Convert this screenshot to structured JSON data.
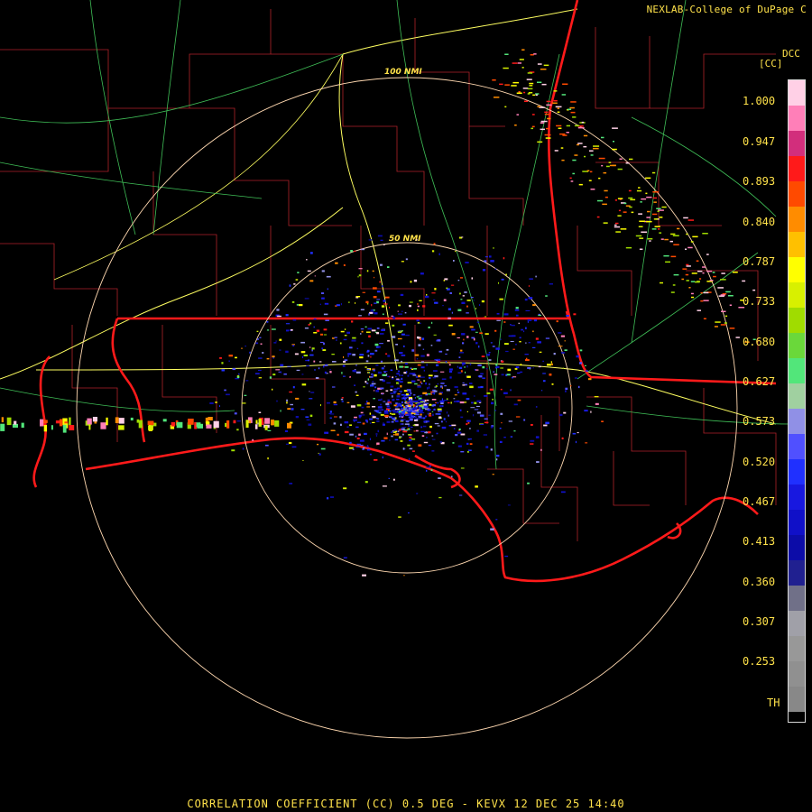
{
  "credit": "NEXLAB-College of DuPage C",
  "product_code": "DCC",
  "product_unit": "[CC]",
  "scale_labels": [
    "1.000",
    "0.947",
    "0.893",
    "0.840",
    "0.787",
    "0.733",
    "0.680",
    "0.627",
    "0.573",
    "0.520",
    "0.467",
    "0.413",
    "0.360",
    "0.307",
    "0.253",
    "TH"
  ],
  "scale_colors": [
    "#ffd0e6",
    "#ff7fb8",
    "#d22e7c",
    "#ff1a1a",
    "#ff4a00",
    "#ff8c00",
    "#ffc000",
    "#ffff00",
    "#d8f000",
    "#a0dc00",
    "#6ad83a",
    "#52e67a",
    "#a0d0a0",
    "#9090e6",
    "#5050ff",
    "#2030ff",
    "#1818e0",
    "#1010c8",
    "#0c0ca8",
    "#202090",
    "#707088",
    "#a0a0a8",
    "#989898",
    "#909090",
    "#888888",
    "#000000"
  ],
  "range_rings": [
    "50 NMI",
    "100 NMI"
  ],
  "footer": "CORRELATION COEFFICIENT (CC) 0.5 DEG - KEVX 12 DEC 25 14:40"
}
